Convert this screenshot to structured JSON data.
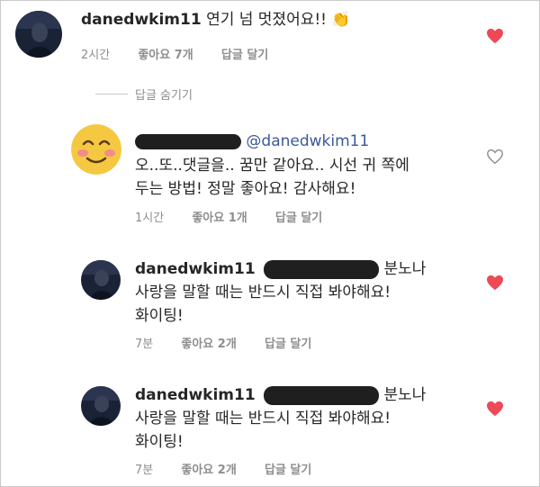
{
  "top_comment": {
    "username": "danedwkim11",
    "text": "연기 넘 멋졌어요!!",
    "emoji": "👏",
    "time": "2시간",
    "likes": "좋아요 7개",
    "reply": "답글 달기",
    "liked": true
  },
  "hide_replies": "답글 숨기기",
  "replies": [
    {
      "mention": "@danedwkim11",
      "line1": "오..또..댓글을.. 꿈만 같아요.. 시선 귀 쪽에",
      "line2": "두는 방법! 정말 좋아요! 감사해요!",
      "time": "1시간",
      "likes": "좋아요 1개",
      "reply": "답글 달기",
      "liked": false
    },
    {
      "username": "danedwkim11",
      "line1_tail": "분노나",
      "line2": "사랑을 말할 때는 반드시 직접 봐야해요!",
      "line3": "화이팅!",
      "time": "7분",
      "likes": "좋아요 2개",
      "reply": "답글 달기",
      "liked": true
    },
    {
      "username": "danedwkim11",
      "line1_tail": "분노나",
      "line2": "사랑을 말할 때는 반드시 직접 봐야해요!",
      "line3": "화이팅!",
      "time": "7분",
      "likes": "좋아요 2개",
      "reply": "답글 달기",
      "liked": true
    }
  ],
  "colors": {
    "heart_liked": "#ed4956",
    "meta_gray": "#8e8e8e",
    "text": "#262626"
  }
}
